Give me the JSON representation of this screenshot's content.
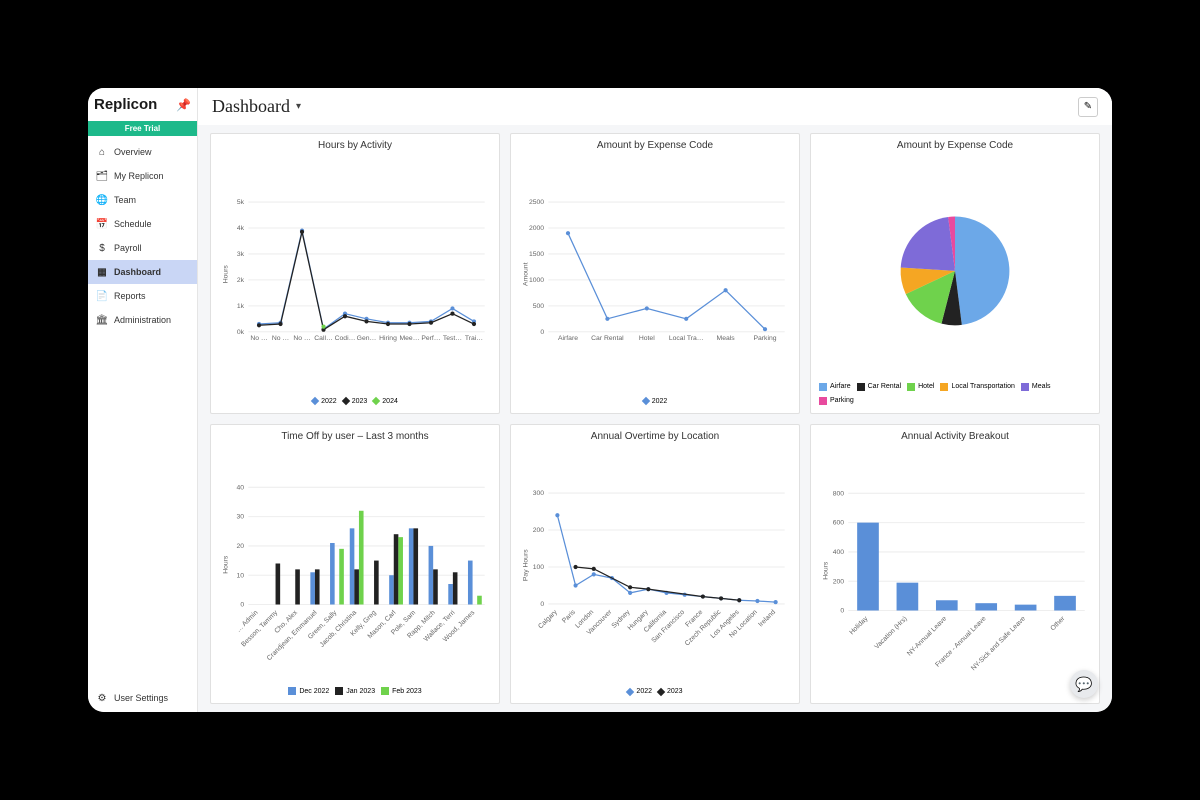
{
  "brand": "Replicon",
  "free_trial_label": "Free Trial",
  "nav": {
    "items": [
      {
        "icon": "home",
        "label": "Overview"
      },
      {
        "icon": "user",
        "label": "My Replicon"
      },
      {
        "icon": "team",
        "label": "Team"
      },
      {
        "icon": "calendar",
        "label": "Schedule"
      },
      {
        "icon": "money",
        "label": "Payroll"
      },
      {
        "icon": "dashboard",
        "label": "Dashboard"
      },
      {
        "icon": "reports",
        "label": "Reports"
      },
      {
        "icon": "admin",
        "label": "Administration"
      }
    ],
    "active_index": 5
  },
  "user_settings_label": "User Settings",
  "page_title": "Dashboard",
  "cards": {
    "hours_by_activity": {
      "title": "Hours by Activity",
      "legend": [
        "2022",
        "2023",
        "2024"
      ]
    },
    "amount_by_expense_line": {
      "title": "Amount by Expense Code",
      "legend": [
        "2022"
      ]
    },
    "amount_by_expense_pie": {
      "title": "Amount by Expense Code",
      "legend": [
        "Airfare",
        "Car Rental",
        "Hotel",
        "Local Transportation",
        "Meals",
        "Parking"
      ]
    },
    "timeoff": {
      "title": "Time Off by user – Last 3 months",
      "legend": [
        "Dec 2022",
        "Jan 2023",
        "Feb 2023"
      ]
    },
    "overtime": {
      "title": "Annual Overtime by Location",
      "legend": [
        "2022",
        "2023"
      ]
    },
    "activity_breakout": {
      "title": "Annual Activity Breakout"
    }
  },
  "colors": {
    "blue": "#5a8fd8",
    "black": "#222",
    "green": "#6fd24c",
    "orange": "#f5a623",
    "purple": "#7e6bd8",
    "pink": "#e84a9e",
    "lightblue": "#6ca8e8"
  },
  "chart_data": [
    {
      "id": "hours_by_activity",
      "type": "line",
      "title": "Hours by Activity",
      "ylabel": "Hours",
      "ylim": [
        0,
        5000
      ],
      "yticks": [
        0,
        1000,
        2000,
        3000,
        4000,
        5000
      ],
      "ytick_labels": [
        "0k",
        "1k",
        "2k",
        "3k",
        "4k",
        "5k"
      ],
      "categories": [
        "No …",
        "No …",
        "No …",
        "Call…",
        "Codi…",
        "Gen…",
        "Hiring",
        "Mee…",
        "Perf…",
        "Test…",
        "Trai…"
      ],
      "series": [
        {
          "name": "2022",
          "color": "#5a8fd8",
          "values": [
            300,
            350,
            3900,
            100,
            700,
            500,
            350,
            350,
            400,
            900,
            400
          ]
        },
        {
          "name": "2023",
          "color": "#222",
          "values": [
            250,
            300,
            3850,
            80,
            600,
            400,
            300,
            300,
            350,
            700,
            300
          ]
        },
        {
          "name": "2024",
          "color": "#6fd24c",
          "values": [
            null,
            null,
            null,
            200,
            null,
            null,
            null,
            null,
            null,
            null,
            null
          ]
        }
      ]
    },
    {
      "id": "amount_by_expense_line",
      "type": "line",
      "title": "Amount by Expense Code",
      "ylabel": "Amount",
      "ylim": [
        0,
        2500
      ],
      "yticks": [
        0,
        500,
        1000,
        1500,
        2000,
        2500
      ],
      "categories": [
        "Airfare",
        "Car Rental",
        "Hotel",
        "Local Tra…",
        "Meals",
        "Parking"
      ],
      "series": [
        {
          "name": "2022",
          "color": "#5a8fd8",
          "values": [
            1900,
            250,
            450,
            250,
            800,
            50
          ]
        }
      ]
    },
    {
      "id": "amount_by_expense_pie",
      "type": "pie",
      "title": "Amount by Expense Code",
      "slices": [
        {
          "name": "Airfare",
          "value": 48,
          "color": "#6ca8e8"
        },
        {
          "name": "Car Rental",
          "value": 6,
          "color": "#222"
        },
        {
          "name": "Hotel",
          "value": 14,
          "color": "#6fd24c"
        },
        {
          "name": "Local Transportation",
          "value": 8,
          "color": "#f5a623"
        },
        {
          "name": "Meals",
          "value": 22,
          "color": "#7e6bd8"
        },
        {
          "name": "Parking",
          "value": 2,
          "color": "#e84a9e"
        }
      ]
    },
    {
      "id": "timeoff",
      "type": "bar",
      "title": "Time Off by user – Last 3 months",
      "ylabel": "Hours",
      "ylim": [
        0,
        40
      ],
      "yticks": [
        0,
        10,
        20,
        30,
        40
      ],
      "categories": [
        "… Admin",
        "Besson, Tammy",
        "Cho, Alex",
        "Crandjean, Emmanuel",
        "Green, Sally",
        "Jacob, Christina",
        "Kelly, Greg",
        "Mason, Carl",
        "Pole, Sam",
        "Rapp, Mitch",
        "Wallace, Terri",
        "Wood, James"
      ],
      "series": [
        {
          "name": "Dec 2022",
          "color": "#5a8fd8",
          "values": [
            0,
            0,
            0,
            11,
            21,
            26,
            0,
            10,
            26,
            20,
            7,
            15
          ]
        },
        {
          "name": "Jan 2023",
          "color": "#222",
          "values": [
            0,
            14,
            12,
            12,
            0,
            12,
            15,
            24,
            26,
            12,
            11,
            0
          ]
        },
        {
          "name": "Feb 2023",
          "color": "#6fd24c",
          "values": [
            0,
            0,
            0,
            0,
            19,
            32,
            0,
            23,
            0,
            0,
            0,
            3
          ]
        }
      ]
    },
    {
      "id": "overtime",
      "type": "line",
      "title": "Annual Overtime by Location",
      "ylabel": "Pay Hours",
      "ylim": [
        0,
        300
      ],
      "yticks": [
        0,
        100,
        200,
        300
      ],
      "categories": [
        "Calgary",
        "Paris",
        "London",
        "Vancouver",
        "Sydney",
        "Hungary",
        "California",
        "San Francisco",
        "France",
        "Czech Republic",
        "Los Angeles",
        "No Location",
        "Ireland"
      ],
      "series": [
        {
          "name": "2022",
          "color": "#5a8fd8",
          "values": [
            240,
            50,
            80,
            70,
            30,
            40,
            30,
            25,
            20,
            15,
            10,
            8,
            5
          ]
        },
        {
          "name": "2023",
          "color": "#222",
          "values": [
            null,
            100,
            95,
            null,
            45,
            40,
            null,
            null,
            20,
            15,
            10,
            null,
            null
          ]
        }
      ]
    },
    {
      "id": "activity_breakout",
      "type": "bar",
      "title": "Annual Activity Breakout",
      "ylabel": "Hours",
      "ylim": [
        0,
        800
      ],
      "yticks": [
        0,
        200,
        400,
        600,
        800
      ],
      "categories": [
        "Holiday",
        "Vacation (Hrs)",
        "NY-Annual Leave",
        "France - Annual Leave",
        "NY-Sick and Safe Leave",
        "Other"
      ],
      "values": [
        600,
        190,
        70,
        50,
        40,
        100
      ]
    }
  ]
}
